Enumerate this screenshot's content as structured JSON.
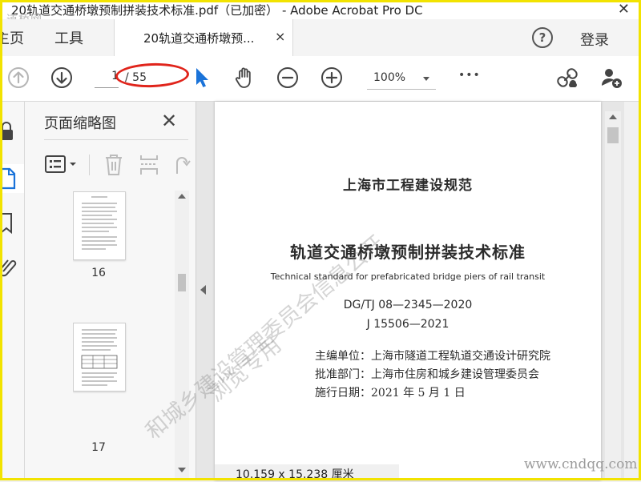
{
  "window": {
    "title": "20轨道交通桥墩预制拼装技术标准.pdf（已加密） - Adobe Acrobat Pro DC",
    "watermark_logo": "道桥网"
  },
  "tabs": {
    "home": "主页",
    "tools": "工具",
    "document": "20轨道交通桥墩预...",
    "close_glyph": "×",
    "help_glyph": "?",
    "login": "登录"
  },
  "toolbar": {
    "current_page": "1",
    "total_pages": "/ 55",
    "zoom": "100%",
    "more_glyph": "•••"
  },
  "thumbnails": {
    "panel_title": "页面缩略图",
    "close_glyph": "✕",
    "pages": [
      {
        "number": "16"
      },
      {
        "number": "17"
      }
    ]
  },
  "document": {
    "header": "上海市工程建设规范",
    "title": "轨道交通桥墩预制拼装技术标准",
    "subtitle_en": "Technical standard for prefabricated bridge piers of rail transit",
    "code1": "DG/TJ 08—2345—2020",
    "code2": "J 15506—2021",
    "editor": "主编单位：上海市隧道工程轨道交通设计研究院",
    "approver": "批准部门：上海市住房和城乡建设管理委员会",
    "date": "施行日期：2021 年 5 月 1 日",
    "page_size": "10.159 x 15.238 厘米"
  },
  "watermarks": {
    "diag1": "和城乡建设管理委员会信息公开",
    "diag2": "浏览专用",
    "site": "www.cndqq.com"
  },
  "colors": {
    "accent_blue": "#1a73d9",
    "highlight_red": "#e0241b",
    "frame_yellow": "#f2e300"
  }
}
